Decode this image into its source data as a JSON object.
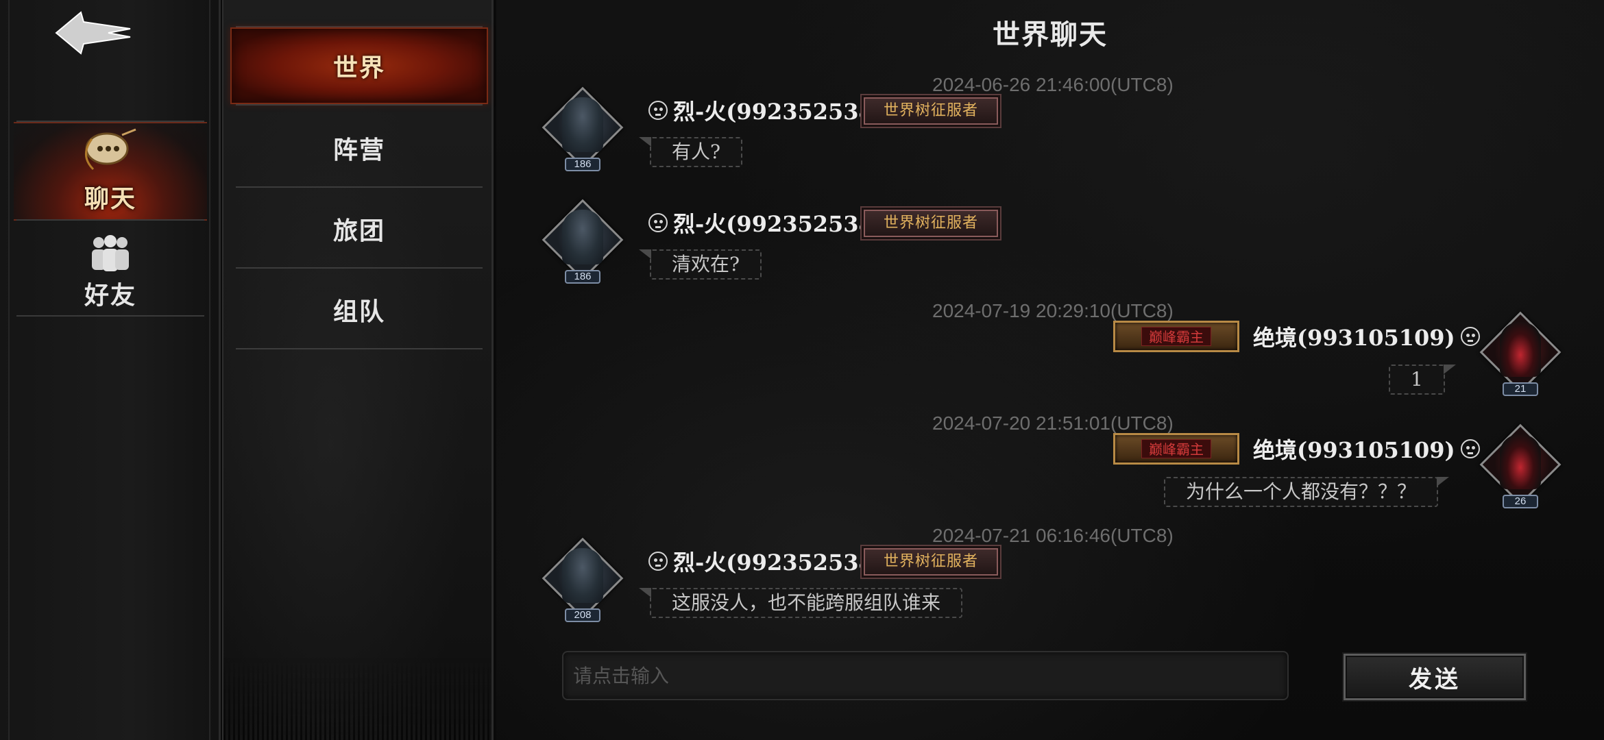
{
  "title": "世界聊天",
  "rail": {
    "back_icon": "back-arrow-icon",
    "items": [
      {
        "label": "聊天",
        "icon": "chat-icon",
        "active": true
      },
      {
        "label": "好友",
        "icon": "friends-icon",
        "active": false
      }
    ]
  },
  "channels": [
    {
      "label": "世界",
      "active": true
    },
    {
      "label": "阵营",
      "active": false
    },
    {
      "label": "旅团",
      "active": false
    },
    {
      "label": "组队",
      "active": false
    }
  ],
  "messages": [
    {
      "timestamp": "2024-06-26 21:46:00(UTC8)",
      "side": "left",
      "user": "烈-火(992352538)",
      "level": "186",
      "badge": "世界树征服者",
      "text": "有人?"
    },
    {
      "timestamp": "",
      "side": "left",
      "user": "烈-火(992352538)",
      "level": "186",
      "badge": "世界树征服者",
      "text": "清欢在?"
    },
    {
      "timestamp": "2024-07-19 20:29:10(UTC8)",
      "side": "right",
      "user": "绝境(993105109)",
      "level": "21",
      "badge": "巅峰霸主",
      "text": "1"
    },
    {
      "timestamp": "2024-07-20 21:51:01(UTC8)",
      "side": "right",
      "user": "绝境(993105109)",
      "level": "26",
      "badge": "巅峰霸主",
      "text": "为什么一个人都没有？？？"
    },
    {
      "timestamp": "2024-07-21 06:16:46(UTC8)",
      "side": "left",
      "user": "烈-火(992352538)",
      "level": "208",
      "badge": "世界树征服者",
      "text": "这服没人，也不能跨服组队谁来"
    }
  ],
  "input": {
    "placeholder": "请点击输入",
    "value": ""
  },
  "send_label": "发送",
  "colors": {
    "active_red": "#b3260e",
    "badge_gold": "#e2b25e",
    "peak_red": "#d23a3a"
  }
}
